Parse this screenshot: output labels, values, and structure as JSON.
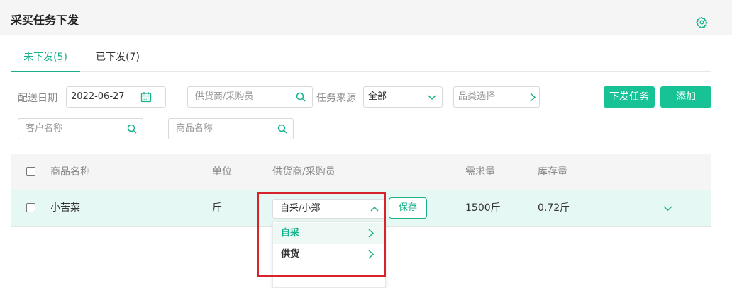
{
  "header": {
    "title": "采买任务下发"
  },
  "tabs": [
    {
      "label": "未下发(5)",
      "active": true
    },
    {
      "label": "已下发(7)",
      "active": false
    }
  ],
  "filters": {
    "date_label": "配送日期",
    "date_value": "2022-06-27",
    "supplier_placeholder": "供货商/采购员",
    "source_label": "任务来源",
    "source_value": "全部",
    "category_placeholder": "品类选择",
    "customer_placeholder": "客户名称",
    "product_placeholder": "商品名称"
  },
  "actions": {
    "dispatch_label": "下发任务",
    "add_label": "添加"
  },
  "table": {
    "columns": [
      "商品名称",
      "单位",
      "供货商/采购员",
      "需求量",
      "库存量"
    ],
    "rows": [
      {
        "name": "小苦菜",
        "unit": "斤",
        "supplier": "自采/小郑",
        "demand": "1500斤",
        "stock": "0.72斤"
      }
    ],
    "save_label": "保存"
  },
  "dropdown": {
    "options": [
      {
        "label": "自采",
        "active": true
      },
      {
        "label": "供货",
        "active": false
      }
    ]
  },
  "colors": {
    "accent": "#17b18c",
    "button": "#17c394",
    "highlight": "#d9232b"
  }
}
